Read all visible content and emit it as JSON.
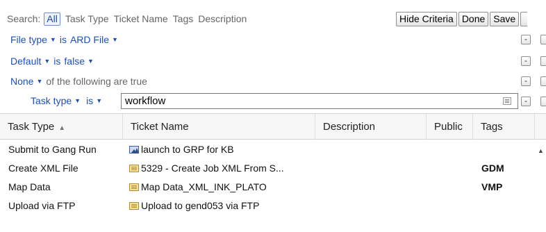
{
  "search": {
    "label": "Search:",
    "tabs": [
      "All",
      "Task Type",
      "Ticket Name",
      "Tags",
      "Description"
    ],
    "active_tab": "All"
  },
  "buttons": {
    "hide_criteria": "Hide Criteria",
    "done": "Done",
    "save": "Save"
  },
  "criteria": [
    {
      "field": "File type",
      "op": "is",
      "value": "ARD File"
    },
    {
      "field": "Default",
      "op": "is",
      "value": "false"
    },
    {
      "field": "None",
      "rest": "of the following are true"
    }
  ],
  "nested_criterion": {
    "field": "Task type",
    "op": "is",
    "value": "workflow"
  },
  "grid": {
    "columns": [
      "Task Type",
      "Ticket Name",
      "Description",
      "Public",
      "Tags"
    ],
    "sort_column": "Task Type",
    "sort_direction": "ascending",
    "rows": [
      {
        "task_type": "Submit to Gang Run",
        "ticket_name": "launch to GRP for KB",
        "icon": "image-icon",
        "description": "",
        "public": "",
        "tags": ""
      },
      {
        "task_type": "Create XML File",
        "ticket_name": "5329 - Create Job XML From S...",
        "icon": "document-icon",
        "description": "",
        "public": "",
        "tags": "GDM"
      },
      {
        "task_type": "Map Data",
        "ticket_name": "Map Data_XML_INK_PLATO",
        "icon": "document-icon",
        "description": "",
        "public": "",
        "tags": "VMP"
      },
      {
        "task_type": "Upload via FTP",
        "ticket_name": "Upload to gend053 via FTP",
        "icon": "document-icon",
        "description": "",
        "public": "",
        "tags": ""
      }
    ]
  },
  "colors": {
    "link": "#1d4fb8",
    "muted_text": "#666666",
    "header_bg": "#f7f7f7"
  }
}
